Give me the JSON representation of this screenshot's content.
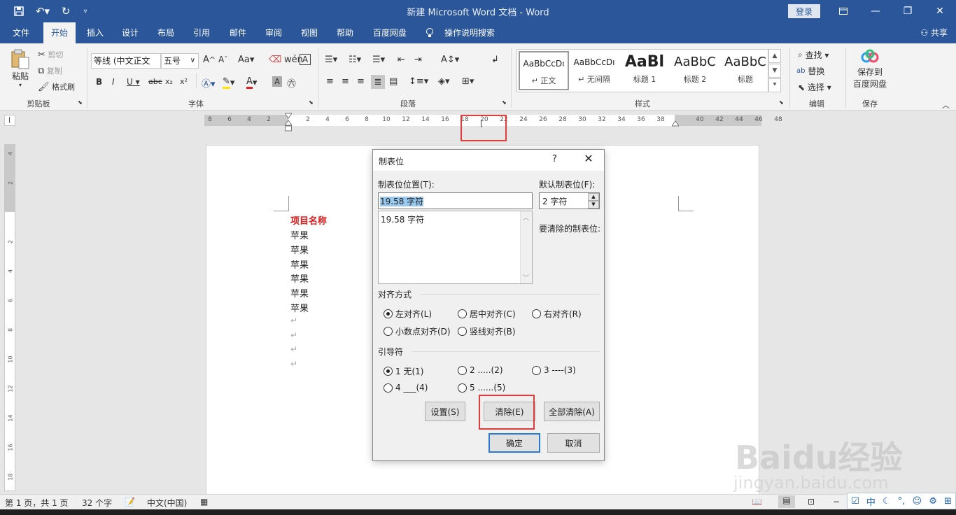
{
  "window": {
    "title": "新建 Microsoft Word 文档  -  Word",
    "login_label": "登录",
    "share_label": "共享"
  },
  "tabs": [
    "文件",
    "开始",
    "插入",
    "设计",
    "布局",
    "引用",
    "邮件",
    "审阅",
    "视图",
    "帮助",
    "百度网盘",
    "操作说明搜索"
  ],
  "active_tab": "开始",
  "ribbon": {
    "clipboard": {
      "group": "剪贴板",
      "paste": "粘贴",
      "cut": "剪切",
      "copy": "复制",
      "format_painter": "格式刷"
    },
    "font": {
      "group": "字体",
      "font_name": "等线 (中文正文",
      "font_size": "五号"
    },
    "paragraph": {
      "group": "段落"
    },
    "styles": {
      "group": "样式",
      "items": [
        {
          "sample": "AaBbCcDı",
          "name": "↵ 正文"
        },
        {
          "sample": "AaBbCcDı",
          "name": "↵ 无间隔"
        },
        {
          "sample": "AaBl",
          "name": "标题 1"
        },
        {
          "sample": "AaBbC",
          "name": "标题 2"
        },
        {
          "sample": "AaBbC",
          "name": "标题"
        }
      ]
    },
    "editing": {
      "group": "编辑",
      "find": "查找",
      "replace": "替换",
      "select": "选择"
    },
    "save": {
      "group": "保存",
      "save_to": "保存到",
      "baidu": "百度网盘"
    }
  },
  "ruler": {
    "ticks": [
      "8",
      "6",
      "4",
      "2",
      "",
      "2",
      "4",
      "6",
      "8",
      "10",
      "12",
      "14",
      "16",
      "18",
      "20",
      "22",
      "24",
      "26",
      "28",
      "30",
      "32",
      "34",
      "36",
      "38",
      "",
      "40",
      "42",
      "44",
      "46",
      "48"
    ],
    "vticks": [
      "4",
      "2",
      "",
      "2",
      "4",
      "6",
      "8",
      "10",
      "12",
      "14",
      "16",
      "18"
    ]
  },
  "document": {
    "heading": "项目名称",
    "items": [
      "苹果",
      "苹果",
      "苹果",
      "苹果",
      "苹果",
      "苹果"
    ],
    "empty_marks": [
      "↵",
      "↵",
      "↵",
      "↵"
    ]
  },
  "dialog": {
    "title": "制表位",
    "help": "?",
    "close": "✕",
    "tab_pos_label": "制表位位置(T):",
    "tab_pos_value": "19.58 字符",
    "list_items": [
      "19.58 字符"
    ],
    "default_label": "默认制表位(F):",
    "default_value": "2 字符",
    "to_clear_label": "要清除的制表位:",
    "alignment_label": "对齐方式",
    "alignment_options": [
      "左对齐(L)",
      "居中对齐(C)",
      "右对齐(R)",
      "小数点对齐(D)",
      "竖线对齐(B)"
    ],
    "alignment_selected": 0,
    "leader_label": "引导符",
    "leader_options": [
      "1 无(1)",
      "2 .....(2)",
      "3 ----(3)",
      "4 ___(4)",
      "5 ......(5)"
    ],
    "leader_selected": 0,
    "set_button": "设置(S)",
    "clear_button": "清除(E)",
    "clear_all_button": "全部清除(A)",
    "ok_button": "确定",
    "cancel_button": "取消"
  },
  "statusbar": {
    "page": "第 1 页，共 1 页",
    "words": "32 个字",
    "language": "中文(中国)"
  },
  "ime": {
    "lang": "中"
  },
  "watermark": {
    "logo": "Baidu经验",
    "url": "jingyan.baidu.com"
  }
}
